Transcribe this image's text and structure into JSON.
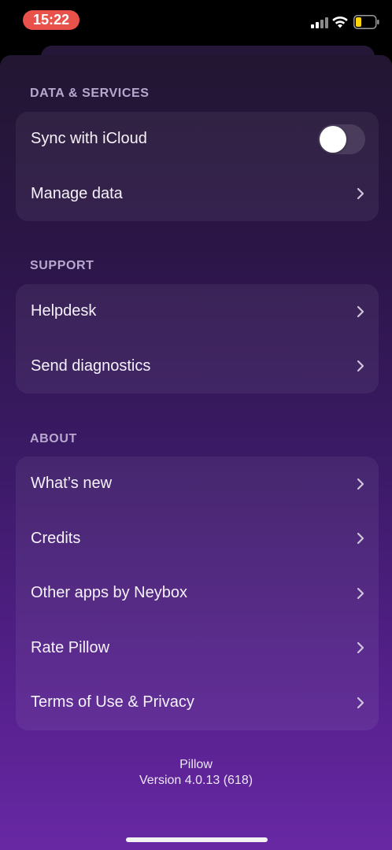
{
  "status_bar": {
    "time": "15:22",
    "icons": [
      "signal-icon",
      "wifi-icon",
      "battery-icon"
    ],
    "time_pill_color": "#e8524a",
    "battery_level_color": "#ffd60a"
  },
  "sections": {
    "data_services": {
      "header": "DATA & SERVICES",
      "items": [
        {
          "label": "Sync with iCloud",
          "control": "toggle",
          "toggle_on": false
        },
        {
          "label": "Manage data",
          "control": "chevron-right-icon"
        }
      ]
    },
    "support": {
      "header": "SUPPORT",
      "items": [
        {
          "label": "Helpdesk",
          "control": "chevron-right-icon"
        },
        {
          "label": "Send diagnostics",
          "control": "chevron-right-icon"
        }
      ]
    },
    "about": {
      "header": "ABOUT",
      "items": [
        {
          "label": "What’s new",
          "control": "chevron-right-icon"
        },
        {
          "label": "Credits",
          "control": "chevron-right-icon"
        },
        {
          "label": "Other apps by Neybox",
          "control": "chevron-right-icon"
        },
        {
          "label": "Rate Pillow",
          "control": "chevron-right-icon"
        },
        {
          "label": "Terms of Use & Privacy",
          "control": "chevron-right-icon"
        }
      ]
    }
  },
  "footer": {
    "app_name": "Pillow",
    "version": "Version 4.0.13 (618)"
  },
  "colors": {
    "background_top": "#221632",
    "background_bottom": "#6a29a6",
    "section_header": "#b8a8cf"
  }
}
